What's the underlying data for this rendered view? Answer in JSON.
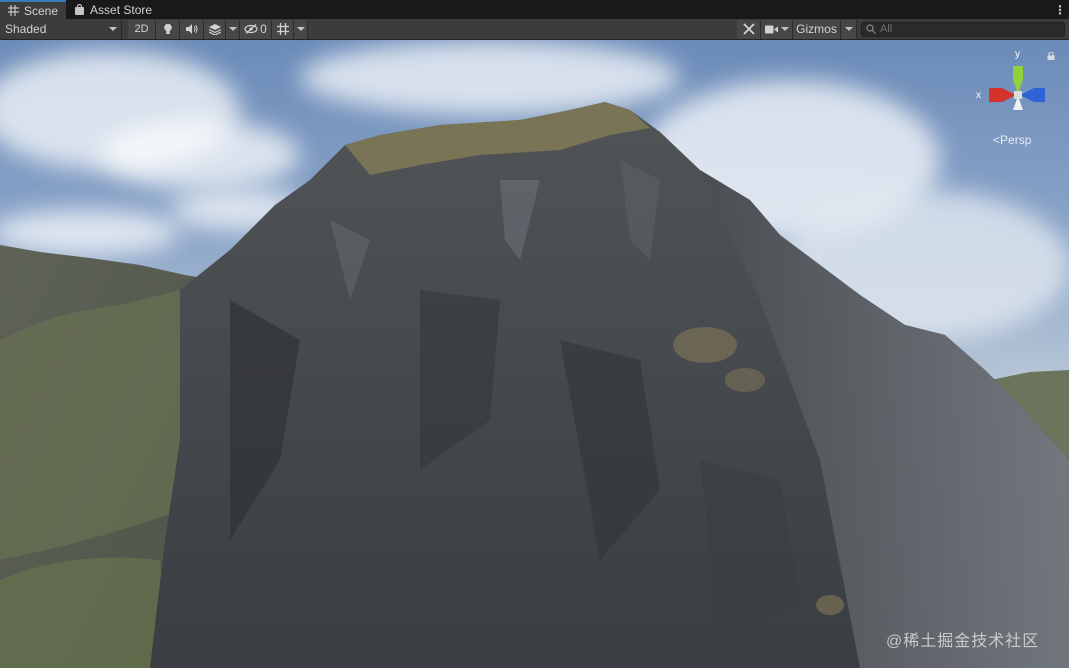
{
  "tabs": {
    "scene": {
      "label": "Scene",
      "icon": "grid-icon"
    },
    "asset_store": {
      "label": "Asset Store",
      "icon": "shopping-bag-icon"
    }
  },
  "toolbar": {
    "draw_mode": "Shaded",
    "two_d": "2D",
    "hidden_count": "0",
    "gizmos": "Gizmos",
    "search_placeholder": "All"
  },
  "scene_view": {
    "projection": "Persp",
    "axes": {
      "x": "x",
      "y": "y"
    },
    "axis_colors": {
      "x": "#d4322c",
      "y": "#8ed13a",
      "z": "#2f64d8"
    }
  },
  "watermark": "@稀土掘金技术社区"
}
